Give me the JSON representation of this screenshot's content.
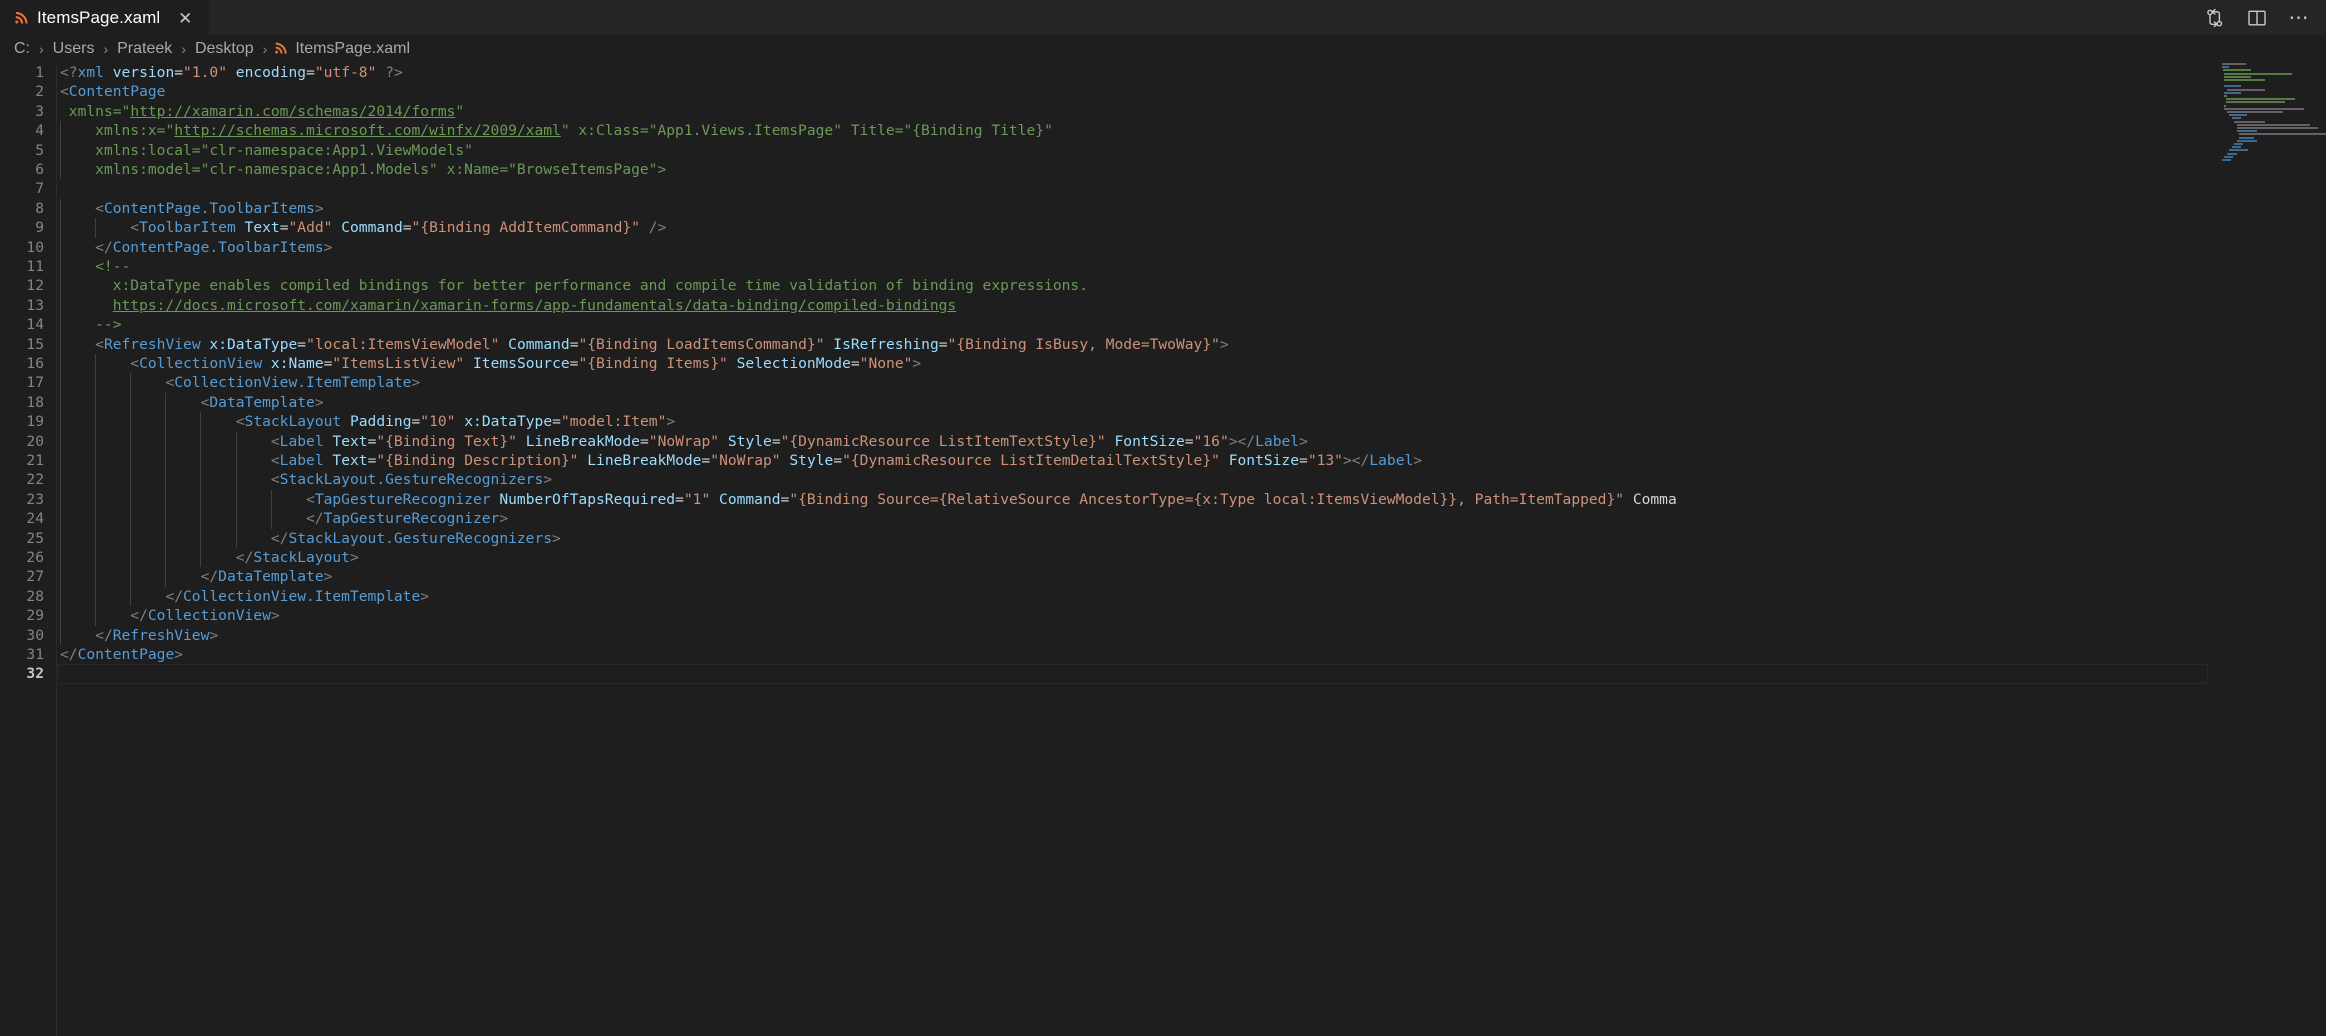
{
  "window": {
    "background": "#1e1e1e",
    "tabbar_background": "#252526"
  },
  "tab": {
    "icon": "xaml-file-icon",
    "icon_glyph": "◤",
    "label": "ItemsPage.xaml",
    "close_glyph": "✕",
    "accent_color": "#e8743b"
  },
  "tabbar_actions": [
    {
      "name": "split-diff-icon",
      "tooltip": "Compare"
    },
    {
      "name": "split-editor-icon",
      "tooltip": "Split Editor Right"
    },
    {
      "name": "more-actions-icon",
      "glyph": "⋯",
      "tooltip": "More Actions..."
    }
  ],
  "breadcrumb": {
    "separator": "›",
    "items": [
      "C:",
      "Users",
      "Prateek",
      "Desktop"
    ],
    "file": "ItemsPage.xaml"
  },
  "editor": {
    "language": "xaml",
    "total_lines": 32,
    "current_line": 32,
    "colors": {
      "tag": "#569cd6",
      "attribute": "#9cdcfe",
      "string": "#ce9178",
      "comment": "#6a9955",
      "punctuation": "#808080",
      "plain": "#d4d4d4",
      "line_number": "#858585",
      "line_number_active": "#c6c6c6",
      "background": "#1e1e1e"
    },
    "lines": [
      {
        "n": 1,
        "text": "<?xml version=\"1.0\" encoding=\"utf-8\" ?>"
      },
      {
        "n": 2,
        "text": "<ContentPage"
      },
      {
        "n": 3,
        "text": " xmlns=\"http://xamarin.com/schemas/2014/forms\""
      },
      {
        "n": 4,
        "text": "    xmlns:x=\"http://schemas.microsoft.com/winfx/2009/xaml\" x:Class=\"App1.Views.ItemsPage\" Title=\"{Binding Title}\""
      },
      {
        "n": 5,
        "text": "    xmlns:local=\"clr-namespace:App1.ViewModels\""
      },
      {
        "n": 6,
        "text": "    xmlns:model=\"clr-namespace:App1.Models\" x:Name=\"BrowseItemsPage\">"
      },
      {
        "n": 7,
        "text": ""
      },
      {
        "n": 8,
        "text": "    <ContentPage.ToolbarItems>"
      },
      {
        "n": 9,
        "text": "        <ToolbarItem Text=\"Add\" Command=\"{Binding AddItemCommand}\" />"
      },
      {
        "n": 10,
        "text": "    </ContentPage.ToolbarItems>"
      },
      {
        "n": 11,
        "text": "    <!--"
      },
      {
        "n": 12,
        "text": "      x:DataType enables compiled bindings for better performance and compile time validation of binding expressions."
      },
      {
        "n": 13,
        "text": "      https://docs.microsoft.com/xamarin/xamarin-forms/app-fundamentals/data-binding/compiled-bindings"
      },
      {
        "n": 14,
        "text": "    -->"
      },
      {
        "n": 15,
        "text": "    <RefreshView x:DataType=\"local:ItemsViewModel\" Command=\"{Binding LoadItemsCommand}\" IsRefreshing=\"{Binding IsBusy, Mode=TwoWay}\">"
      },
      {
        "n": 16,
        "text": "        <CollectionView x:Name=\"ItemsListView\" ItemsSource=\"{Binding Items}\" SelectionMode=\"None\">"
      },
      {
        "n": 17,
        "text": "            <CollectionView.ItemTemplate>"
      },
      {
        "n": 18,
        "text": "                <DataTemplate>"
      },
      {
        "n": 19,
        "text": "                    <StackLayout Padding=\"10\" x:DataType=\"model:Item\">"
      },
      {
        "n": 20,
        "text": "                        <Label Text=\"{Binding Text}\" LineBreakMode=\"NoWrap\" Style=\"{DynamicResource ListItemTextStyle}\" FontSize=\"16\"></Label>"
      },
      {
        "n": 21,
        "text": "                        <Label Text=\"{Binding Description}\" LineBreakMode=\"NoWrap\" Style=\"{DynamicResource ListItemDetailTextStyle}\" FontSize=\"13\"></Label>"
      },
      {
        "n": 22,
        "text": "                        <StackLayout.GestureRecognizers>"
      },
      {
        "n": 23,
        "text": "                            <TapGestureRecognizer NumberOfTapsRequired=\"1\" Command=\"{Binding Source={RelativeSource AncestorType={x:Type local:ItemsViewModel}}, Path=ItemTapped}\" Comma"
      },
      {
        "n": 24,
        "text": "                            </TapGestureRecognizer>"
      },
      {
        "n": 25,
        "text": "                        </StackLayout.GestureRecognizers>"
      },
      {
        "n": 26,
        "text": "                    </StackLayout>"
      },
      {
        "n": 27,
        "text": "                </DataTemplate>"
      },
      {
        "n": 28,
        "text": "            </CollectionView.ItemTemplate>"
      },
      {
        "n": 29,
        "text": "        </CollectionView>"
      },
      {
        "n": 30,
        "text": "    </RefreshView>"
      },
      {
        "n": 31,
        "text": "</ContentPage>"
      },
      {
        "n": 32,
        "text": ""
      }
    ]
  },
  "minimap": {
    "visible": true,
    "width": 111
  }
}
